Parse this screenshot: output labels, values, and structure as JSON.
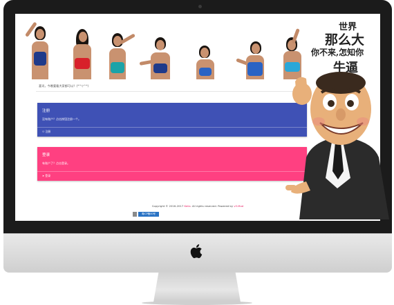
{
  "notice": "喜讯，今晚要看大家都可以？(*^▽^*)",
  "register": {
    "title": "注册",
    "desc": "没有账户？点击按钮注册一个。",
    "action": "注册"
  },
  "login": {
    "title": "登录",
    "desc": "有账户了？点击登录。",
    "action": "登录"
  },
  "footer": {
    "prefix": "Copyright © 2016-2017",
    "site": "Keila",
    "mid": ". All rights reserved. Powered by",
    "powered": "v3.Mod"
  },
  "badge": "粤ICP备00号",
  "slogan": {
    "line1": "世界",
    "line2": "那么大",
    "line3": "你不来,怎知你",
    "line4": "牛逼"
  },
  "colors": {
    "register": "#3f51b5",
    "login": "#ff4081",
    "accent": "#e91e63"
  }
}
